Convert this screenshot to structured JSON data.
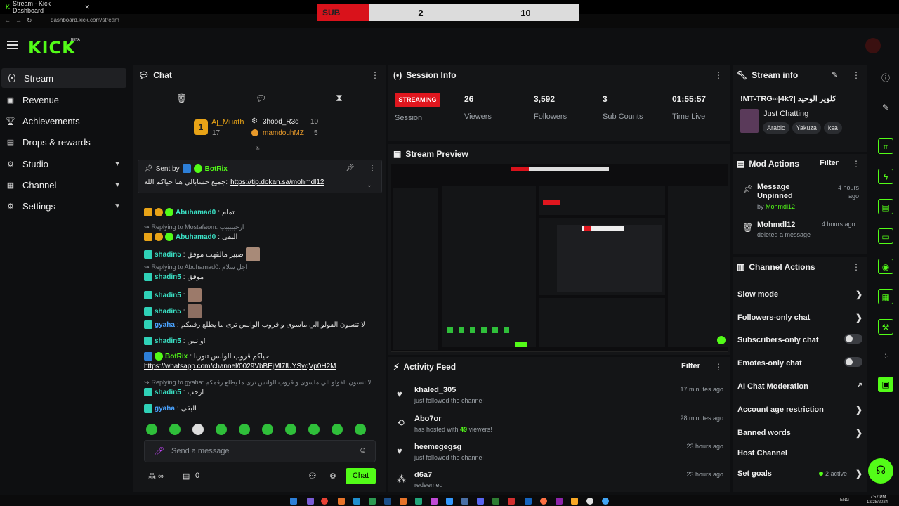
{
  "browser": {
    "tab_title": "Stream - Kick Dashboard",
    "url": "dashboard.kick.com/stream"
  },
  "scorebar": {
    "label": "SUB",
    "left_score": "2",
    "right_score": "10"
  },
  "header": {
    "logo": "KICK",
    "beta": "BETA"
  },
  "sidebar": {
    "items": [
      {
        "label": "Stream",
        "icon": "broadcast-icon",
        "active": true
      },
      {
        "label": "Revenue",
        "icon": "wallet-icon"
      },
      {
        "label": "Achievements",
        "icon": "trophy-icon"
      },
      {
        "label": "Drops & rewards",
        "icon": "gift-icon"
      },
      {
        "label": "Studio",
        "icon": "studio-icon",
        "expandable": true
      },
      {
        "label": "Channel",
        "icon": "channel-icon",
        "expandable": true
      },
      {
        "label": "Settings",
        "icon": "gear-icon",
        "expandable": true
      }
    ]
  },
  "chat": {
    "title": "Chat",
    "leaderboard": {
      "first": {
        "rank": "1",
        "name": "Aj_Muath",
        "count": "17"
      },
      "second": {
        "name": "3hood_R3d",
        "count": "10"
      },
      "third": {
        "name": "mamdouhMZ",
        "count": "5"
      }
    },
    "pinned": {
      "sent_by_label": "Sent by",
      "sender": "BotRix",
      "text": "جميع حسابالي هنا حياكم الله:",
      "link": "https://tip.dokan.sa/mohmdl12"
    },
    "messages": [
      {
        "user": "Abuhamad0",
        "text": "تمام"
      },
      {
        "reply": "Replying to Mostafaom: ارحبببببب"
      },
      {
        "user": "Abuhamad0",
        "text": "البقى"
      },
      {
        "user": "shadin5",
        "text": "صبير مالقهت موفق"
      },
      {
        "reply": "Replying to Abuhamad0: اجل سلام"
      },
      {
        "user": "shadin5",
        "text": "موفق"
      },
      {
        "user": "shadin5",
        "text": ""
      },
      {
        "user": "shadin5",
        "text": ""
      },
      {
        "user": "gyaha",
        "text": "لا تنسون الفولو الي ماسوى و قروب الوانس ترى ما يطلع رقمكم"
      },
      {
        "user": "shadin5",
        "text": "وانس!"
      },
      {
        "user": "BotRix",
        "text": ": حياكم قروب الوانس تنورنا"
      },
      {
        "link": "https://whatsapp.com/channel/0029VbBEjMl7lUYSyqVp0H2M"
      },
      {
        "reply": "Replying to gyaha: لا تنسون الفولو الي ماسوى و قروب الوانس ترى ما يطلع رقمكم"
      },
      {
        "user": "shadin5",
        "text": "ارحب"
      },
      {
        "user": "gyaha",
        "text": "البقى"
      }
    ],
    "input_placeholder": "Send a message",
    "send_label": "Chat",
    "viewer_count": "0"
  },
  "session": {
    "title": "Session Info",
    "status": "STREAMING",
    "session_label": "Session",
    "stats": [
      {
        "value": "26",
        "label": "Viewers"
      },
      {
        "value": "3,592",
        "label": "Followers"
      },
      {
        "value": "3",
        "label": "Sub Counts"
      },
      {
        "value": "01:55:57",
        "label": "Time Live"
      }
    ]
  },
  "preview": {
    "title": "Stream Preview"
  },
  "activity": {
    "title": "Activity Feed",
    "filter_label": "Filter",
    "items": [
      {
        "name": "khaled_305",
        "desc": "just followed the channel",
        "time": "17 minutes ago"
      },
      {
        "name": "Abo7or",
        "desc_prefix": "has hosted with",
        "count": "49",
        "desc_suffix": "viewers!",
        "time": "28 minutes ago"
      },
      {
        "name": "heemegegsg",
        "desc": "just followed the channel",
        "time": "23 hours ago"
      },
      {
        "name": "d6a7",
        "desc": "redeemed",
        "time": "23 hours ago"
      }
    ]
  },
  "stream_info": {
    "title": "Stream info",
    "stream_title": "!MT-TRG∞|4k?| كلوير الوحيد",
    "category": "Just Chatting",
    "tags": [
      "Arabic",
      "Yakuza",
      "ksa"
    ]
  },
  "mod_actions": {
    "title": "Mod Actions",
    "filter_label": "Filter",
    "items": [
      {
        "action": "Message Unpinned",
        "by_prefix": "by",
        "by": "Mohmdl12",
        "time": "4 hours ago"
      },
      {
        "action": "Mohmdl12",
        "desc": "deleted a message",
        "time": "4 hours ago"
      }
    ]
  },
  "channel_actions": {
    "title": "Channel Actions",
    "items": [
      {
        "label": "Slow mode",
        "control": "chevron"
      },
      {
        "label": "Followers-only chat",
        "control": "chevron"
      },
      {
        "label": "Subscribers-only chat",
        "control": "toggle",
        "on": false
      },
      {
        "label": "Emotes-only chat",
        "control": "toggle",
        "on": false
      },
      {
        "label": "AI Chat Moderation",
        "control": "external"
      },
      {
        "label": "Account age restriction",
        "control": "chevron"
      },
      {
        "label": "Banned words",
        "control": "chevron"
      },
      {
        "label": "Host Channel",
        "control": "none"
      },
      {
        "label": "Set goals",
        "control": "chevron",
        "extra": "2 active"
      }
    ]
  },
  "taskbar": {
    "lang": "ENG",
    "time": "7:57 PM",
    "date": "12/28/2024"
  },
  "colors": {
    "accent": "#53fc18",
    "live": "#e0161e",
    "panel": "#141517",
    "bg": "#0e0f11"
  }
}
